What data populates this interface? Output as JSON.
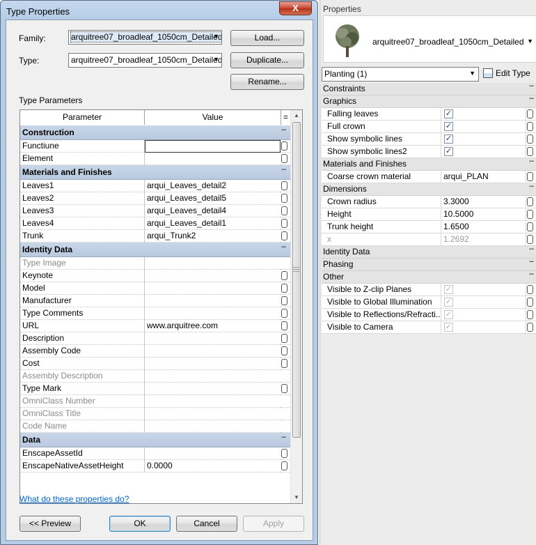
{
  "dialog": {
    "title": "Type Properties",
    "close_label": "X",
    "family_label": "Family:",
    "family_value": "arquitree07_broadleaf_1050cm_Detailed",
    "type_label": "Type:",
    "type_value": "arquitree07_broadleaf_1050cm_Detailed",
    "load_label": "Load...",
    "duplicate_label": "Duplicate...",
    "rename_label": "Rename...",
    "type_parameters_label": "Type Parameters",
    "col_parameter": "Parameter",
    "col_value": "Value",
    "col_sort": "=",
    "help_link": "What do these properties do?",
    "preview_label": "<< Preview",
    "ok_label": "OK",
    "cancel_label": "Cancel",
    "apply_label": "Apply",
    "groups": [
      {
        "name": "Construction",
        "rows": [
          {
            "param": "Functiune",
            "value": "",
            "editing": true
          },
          {
            "param": "Element",
            "value": ""
          }
        ]
      },
      {
        "name": "Materials and Finishes",
        "rows": [
          {
            "param": "Leaves1",
            "value": "arqui_Leaves_detail2"
          },
          {
            "param": "Leaves2",
            "value": "arqui_Leaves_detail5"
          },
          {
            "param": "Leaves3",
            "value": "arqui_Leaves_detail4"
          },
          {
            "param": "Leaves4",
            "value": "arqui_Leaves_detail1"
          },
          {
            "param": "Trunk",
            "value": "arqui_Trunk2"
          }
        ]
      },
      {
        "name": "Identity Data",
        "rows": [
          {
            "param": "Type Image",
            "value": "",
            "disabled": true
          },
          {
            "param": "Keynote",
            "value": ""
          },
          {
            "param": "Model",
            "value": ""
          },
          {
            "param": "Manufacturer",
            "value": ""
          },
          {
            "param": "Type Comments",
            "value": ""
          },
          {
            "param": "URL",
            "value": "www.arquitree.com"
          },
          {
            "param": "Description",
            "value": ""
          },
          {
            "param": "Assembly Code",
            "value": ""
          },
          {
            "param": "Cost",
            "value": ""
          },
          {
            "param": "Assembly Description",
            "value": "",
            "disabled": true
          },
          {
            "param": "Type Mark",
            "value": ""
          },
          {
            "param": "OmniClass Number",
            "value": "",
            "disabled": true
          },
          {
            "param": "OmniClass Title",
            "value": "",
            "disabled": true
          },
          {
            "param": "Code Name",
            "value": "",
            "disabled": true
          }
        ]
      },
      {
        "name": "Data",
        "rows": [
          {
            "param": "EnscapeAssetId",
            "value": ""
          },
          {
            "param": "EnscapeNativeAssetHeight",
            "value": "0.0000"
          }
        ]
      }
    ]
  },
  "palette": {
    "title": "Properties",
    "type_name": "arquitree07_broadleaf_1050cm_Detailed",
    "instance_filter": "Planting (1)",
    "edit_type_label": "Edit Type",
    "sections": [
      {
        "name": "Constraints",
        "chevron": "down",
        "rows": []
      },
      {
        "name": "Graphics",
        "chevron": "up",
        "rows": [
          {
            "param": "Falling leaves",
            "check": true
          },
          {
            "param": "Full crown",
            "check": true
          },
          {
            "param": "Show symbolic lines",
            "check": true
          },
          {
            "param": "Show symbolic lines2",
            "check": true
          }
        ]
      },
      {
        "name": "Materials and Finishes",
        "chevron": "up",
        "rows": [
          {
            "param": "Coarse crown material",
            "value": "arqui_PLAN"
          }
        ]
      },
      {
        "name": "Dimensions",
        "chevron": "up",
        "rows": [
          {
            "param": "Crown radius",
            "value": "3.3000"
          },
          {
            "param": "Height",
            "value": "10.5000"
          },
          {
            "param": "Trunk height",
            "value": "1.6500"
          },
          {
            "param": "x",
            "value": "1.2692",
            "dim": true
          }
        ]
      },
      {
        "name": "Identity Data",
        "chevron": "down",
        "rows": []
      },
      {
        "name": "Phasing",
        "chevron": "down",
        "rows": []
      },
      {
        "name": "Other",
        "chevron": "up",
        "rows": [
          {
            "param": "Visible to Z-clip Planes",
            "check": true,
            "grey": true
          },
          {
            "param": "Visible to Global Illumination",
            "check": true,
            "grey": true
          },
          {
            "param": "Visible to Reflections/Refracti...",
            "check": true,
            "grey": true
          },
          {
            "param": "Visible to Camera",
            "check": true,
            "grey": true
          }
        ]
      }
    ]
  }
}
